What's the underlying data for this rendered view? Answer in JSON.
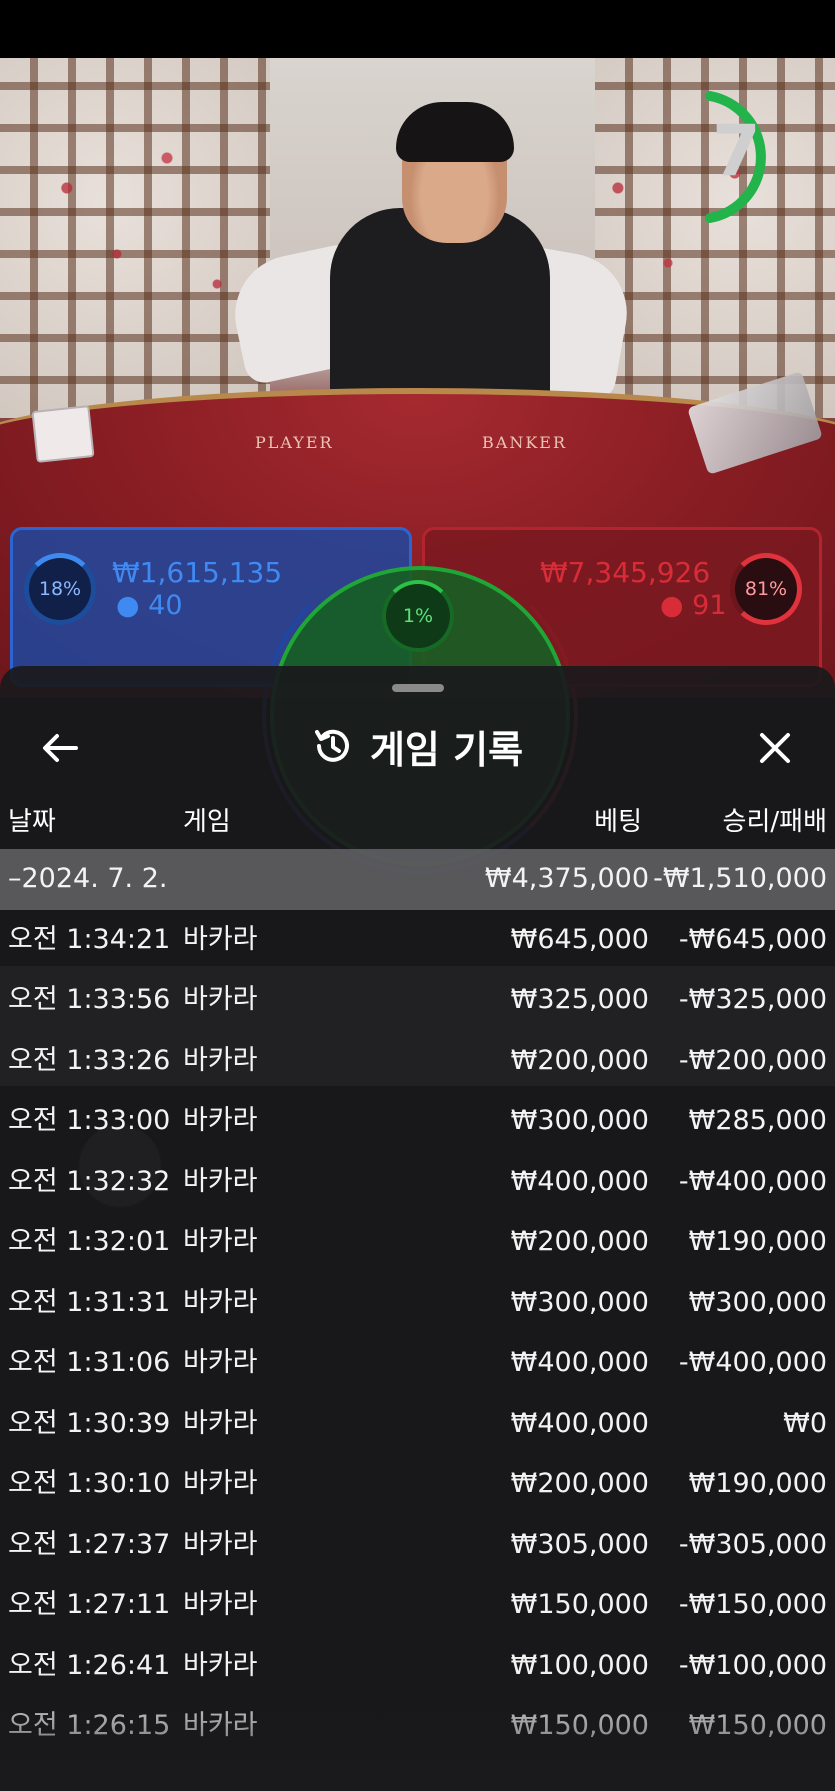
{
  "timer": {
    "value": "7"
  },
  "table": {
    "player_label": "PLAYER",
    "banker_label": "BANKER"
  },
  "bets": {
    "player": {
      "percent": "18%",
      "amount": "₩1,615,135",
      "players": "40"
    },
    "tie": {
      "percent": "1%"
    },
    "banker": {
      "percent": "81%",
      "amount": "₩7,345,926",
      "players": "91"
    }
  },
  "sheet": {
    "title": "게임 기록",
    "icons": {
      "back": "arrow-left-icon",
      "title": "history-clock-icon",
      "close": "close-x-icon"
    },
    "columns": {
      "date": "날짜",
      "game": "게임",
      "bet": "베팅",
      "winloss": "승리/패배"
    },
    "summary": {
      "date": "–2024. 7. 2.",
      "bet": "₩4,375,000",
      "winloss": "-₩1,510,000"
    },
    "rows": [
      {
        "time": "오전 1:34:21",
        "game": "바카라",
        "bet": "₩645,000",
        "winloss": "-₩645,000"
      },
      {
        "time": "오전 1:33:56",
        "game": "바카라",
        "bet": "₩325,000",
        "winloss": "-₩325,000"
      },
      {
        "time": "오전 1:33:26",
        "game": "바카라",
        "bet": "₩200,000",
        "winloss": "-₩200,000"
      },
      {
        "time": "오전 1:33:00",
        "game": "바카라",
        "bet": "₩300,000",
        "winloss": "₩285,000"
      },
      {
        "time": "오전 1:32:32",
        "game": "바카라",
        "bet": "₩400,000",
        "winloss": "-₩400,000"
      },
      {
        "time": "오전 1:32:01",
        "game": "바카라",
        "bet": "₩200,000",
        "winloss": "₩190,000"
      },
      {
        "time": "오전 1:31:31",
        "game": "바카라",
        "bet": "₩300,000",
        "winloss": "₩300,000"
      },
      {
        "time": "오전 1:31:06",
        "game": "바카라",
        "bet": "₩400,000",
        "winloss": "-₩400,000"
      },
      {
        "time": "오전 1:30:39",
        "game": "바카라",
        "bet": "₩400,000",
        "winloss": "₩0"
      },
      {
        "time": "오전 1:30:10",
        "game": "바카라",
        "bet": "₩200,000",
        "winloss": "₩190,000"
      },
      {
        "time": "오전 1:27:37",
        "game": "바카라",
        "bet": "₩305,000",
        "winloss": "-₩305,000"
      },
      {
        "time": "오전 1:27:11",
        "game": "바카라",
        "bet": "₩150,000",
        "winloss": "-₩150,000"
      },
      {
        "time": "오전 1:26:41",
        "game": "바카라",
        "bet": "₩100,000",
        "winloss": "-₩100,000"
      },
      {
        "time": "오전 1:26:15",
        "game": "바카라",
        "bet": "₩150,000",
        "winloss": "₩150,000"
      }
    ]
  },
  "colors": {
    "player": "#2c65d1",
    "banker": "#b3242e",
    "tie": "#1fa636",
    "timer": "#22b34a",
    "sheet_bg": "#1a1a1c",
    "summary_row": "#6e6e72"
  }
}
